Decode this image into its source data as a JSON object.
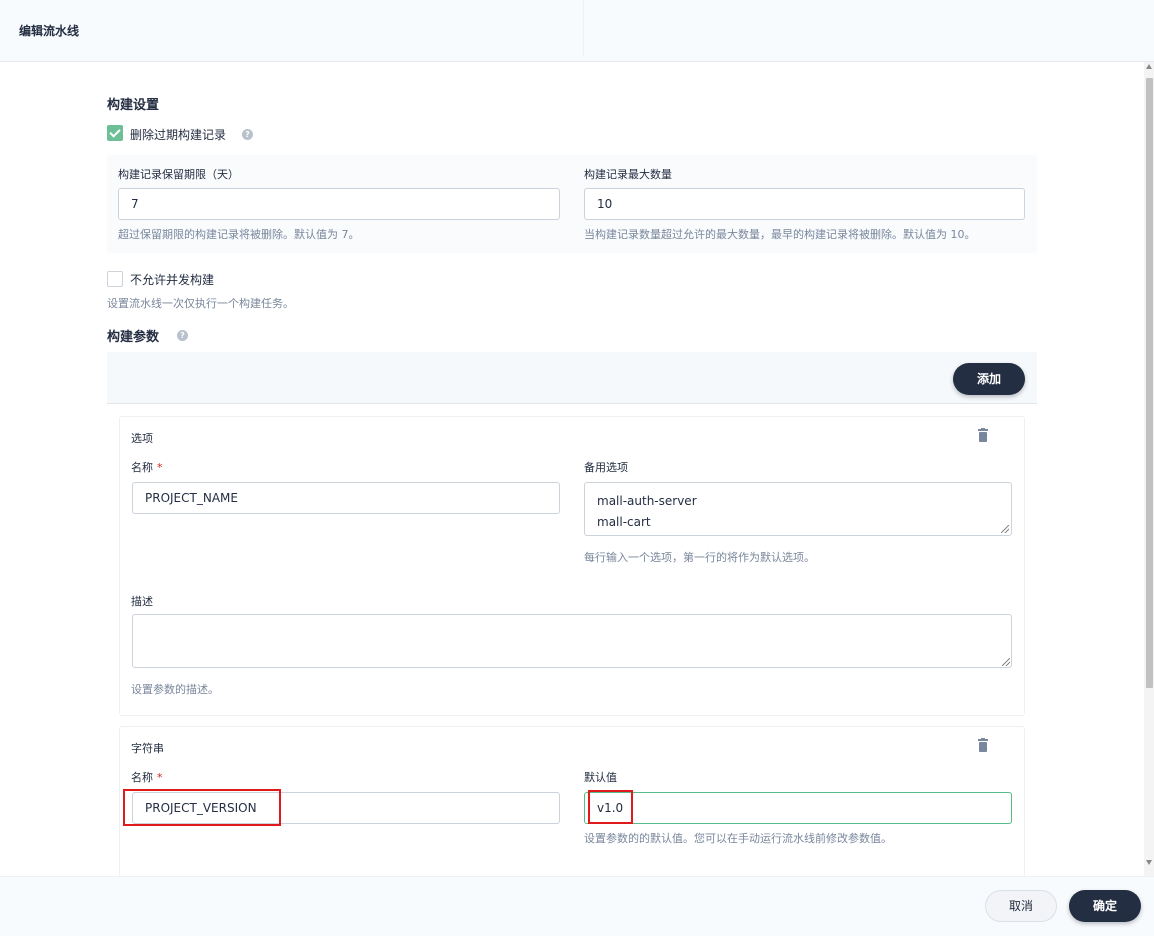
{
  "header": {
    "title": "编辑流水线"
  },
  "build_settings": {
    "title": "构建设置",
    "discard_old_builds": {
      "label": "删除过期构建记录",
      "checked": true
    },
    "retention_days": {
      "label": "构建记录保留期限（天）",
      "value": "7",
      "hint": "超过保留期限的构建记录将被删除。默认值为 7。"
    },
    "max_builds": {
      "label": "构建记录最大数量",
      "value": "10",
      "hint": "当构建记录数量超过允许的最大数量，最早的构建记录将被删除。默认值为 10。"
    },
    "no_concurrent": {
      "label": "不允许并发构建",
      "checked": false,
      "hint": "设置流水线一次仅执行一个构建任务。"
    }
  },
  "build_params": {
    "title": "构建参数",
    "add_label": "添加",
    "choice_param": {
      "type_label": "选项",
      "name_label": "名称",
      "name_required_mark": "*",
      "name_value": "PROJECT_NAME",
      "options_label": "备用选项",
      "options_lines": [
        "mall-auth-server",
        "mall-cart"
      ],
      "options_hint": "每行输入一个选项，第一行的将作为默认选项。",
      "desc_label": "描述",
      "desc_value": "",
      "desc_hint": "设置参数的描述。"
    },
    "string_param": {
      "type_label": "字符串",
      "name_label": "名称",
      "name_required_mark": "*",
      "name_value": "PROJECT_VERSION",
      "default_label": "默认值",
      "default_value": "v1.0",
      "default_hint": "设置参数的的默认值。您可以在手动运行流水线前修改参数值。"
    }
  },
  "footer": {
    "cancel_label": "取消",
    "ok_label": "确定"
  },
  "icons": {
    "help": "help-icon",
    "trash": "trash-icon",
    "check": "check-icon"
  },
  "colors": {
    "accent": "#55bc8a",
    "dark_button": "#242e42",
    "highlight": "#e01a1a"
  }
}
